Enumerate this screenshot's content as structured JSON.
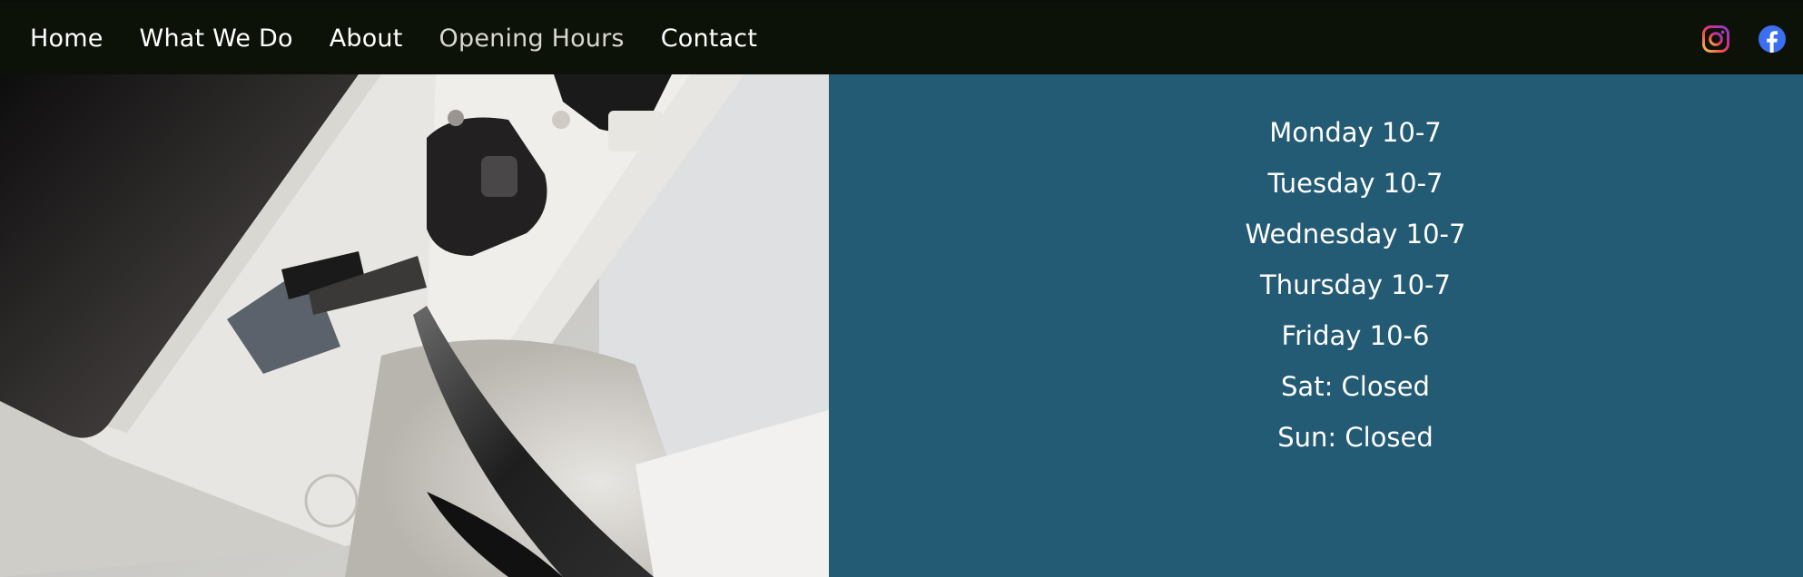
{
  "nav": {
    "items": [
      {
        "label": "Home",
        "active": false
      },
      {
        "label": "What We Do",
        "active": false
      },
      {
        "label": "About",
        "active": false
      },
      {
        "label": "Opening Hours",
        "active": true
      },
      {
        "label": "Contact",
        "active": false
      }
    ]
  },
  "social": {
    "icons": [
      "instagram-icon",
      "facebook-icon"
    ]
  },
  "hero_image": {
    "subject": "phone-repair-photo"
  },
  "opening_hours": {
    "lines": [
      "Monday 10-7",
      "Tuesday 10-7",
      "Wednesday 10-7",
      "Thursday 10-7",
      "Friday 10-6",
      "Sat: Closed",
      "Sun: Closed"
    ]
  },
  "colors": {
    "navbar_bg": "#0c1208",
    "panel_bg": "#235a74",
    "text": "#ffffff",
    "active_nav": "#d9d6d0",
    "facebook_blue": "#3b6ff0"
  }
}
